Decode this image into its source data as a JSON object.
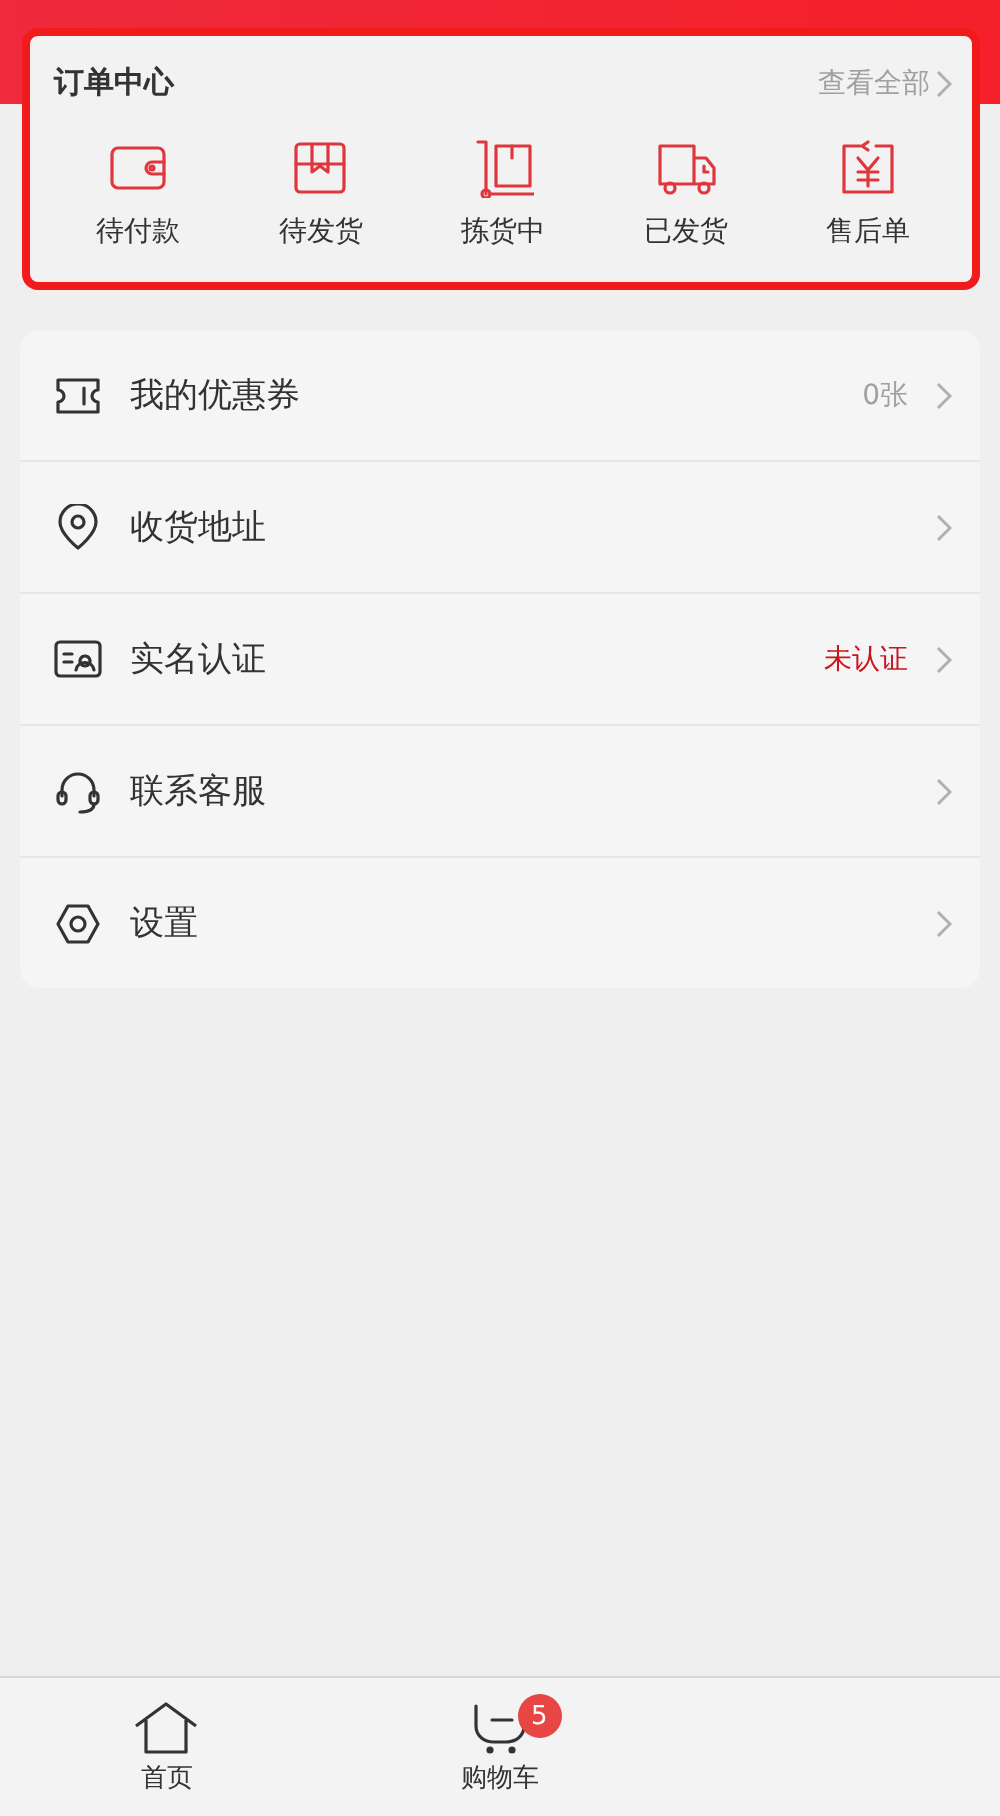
{
  "order_center": {
    "title": "订单中心",
    "view_all": "查看全部",
    "items": [
      {
        "label": "待付款"
      },
      {
        "label": "待发货"
      },
      {
        "label": "拣货中"
      },
      {
        "label": "已发货"
      },
      {
        "label": "售后单"
      }
    ]
  },
  "menu": [
    {
      "label": "我的优惠券",
      "value": "0张",
      "alert": false
    },
    {
      "label": "收货地址"
    },
    {
      "label": "实名认证",
      "value": "未认证",
      "alert": true
    },
    {
      "label": "联系客服"
    },
    {
      "label": "设置"
    }
  ],
  "tab_bar": [
    {
      "label": "首页"
    },
    {
      "label": "购物车",
      "badge": "5"
    }
  ]
}
